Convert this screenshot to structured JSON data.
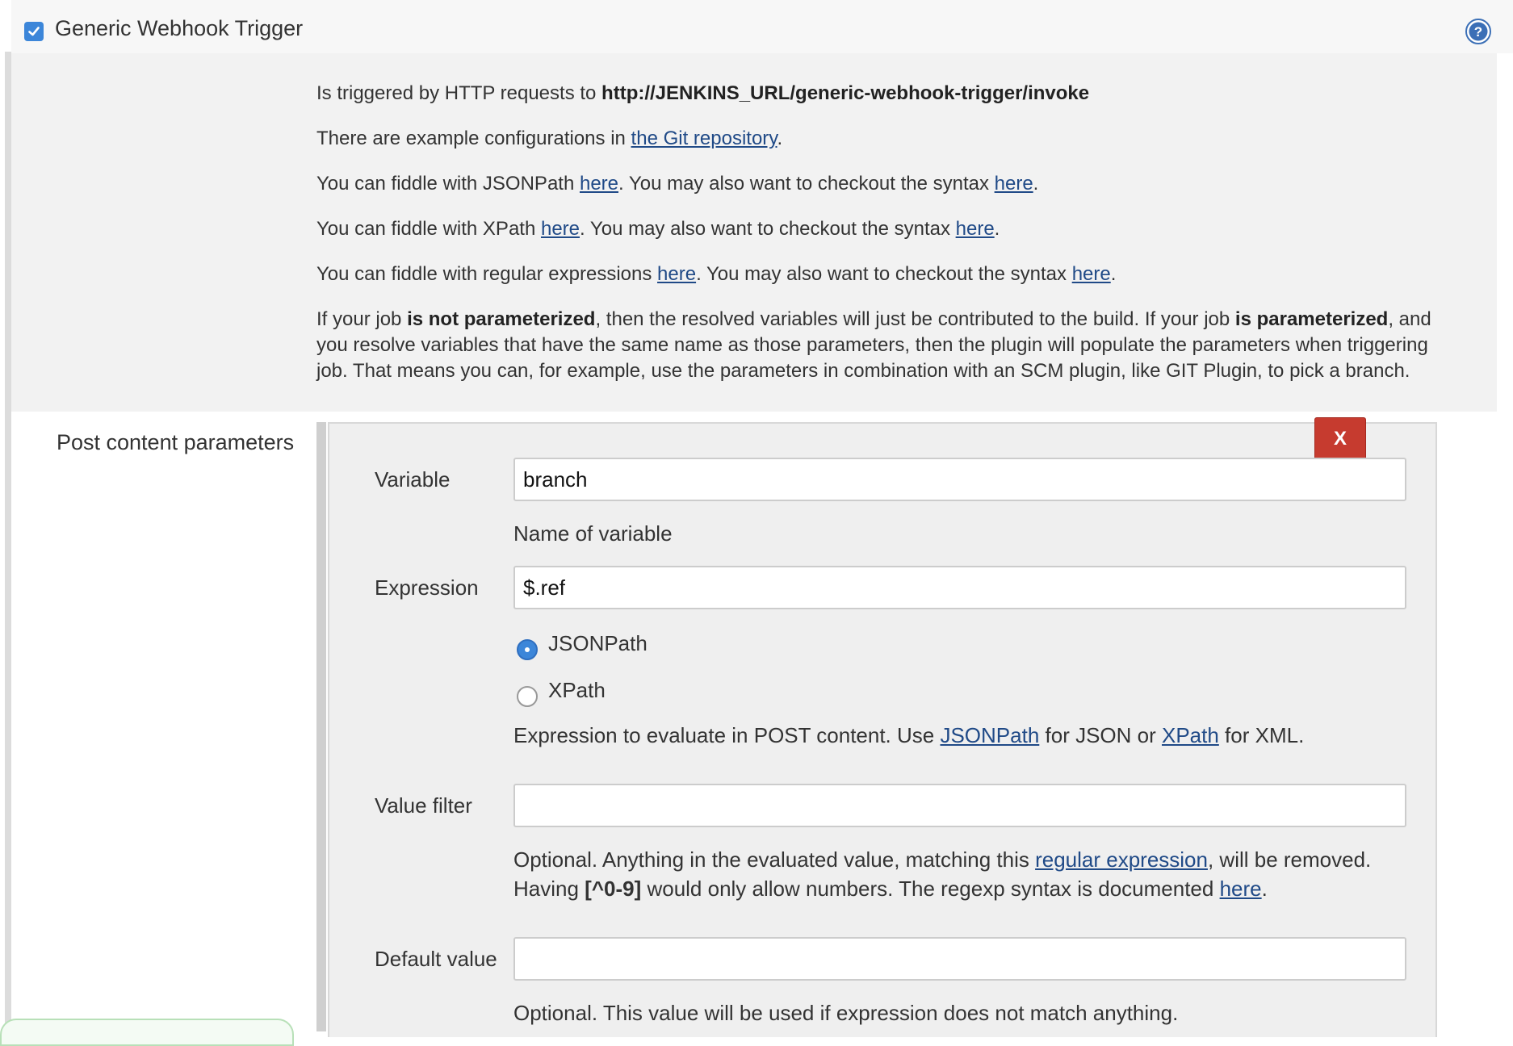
{
  "header": {
    "checkbox_checked": true,
    "title": "Generic Webhook Trigger",
    "help_icon": "question-circle-icon"
  },
  "description": {
    "line1_prefix": "Is triggered by HTTP requests to ",
    "line1_url": "http://JENKINS_URL/generic-webhook-trigger/invoke",
    "line2_prefix": "There are example configurations in ",
    "line2_link": "the Git repository",
    "line2_suffix": ".",
    "jsonpath_prefix": "You can fiddle with JSONPath ",
    "xpath_prefix": "You can fiddle with XPath ",
    "regex_prefix": "You can fiddle with regular expressions ",
    "here": "here",
    "syntax_middle": ". You may also want to checkout the syntax ",
    "period": ".",
    "param_1": "If your job ",
    "param_bold_1": "is not parameterized",
    "param_2": ", then the resolved variables will just be contributed to the build. If your job ",
    "param_bold_2": "is parameterized",
    "param_3": ", and you resolve variables that have the same name as those parameters, then the plugin will populate the parameters when triggering job. That means you can, for example, use the parameters in combination with an SCM plugin, like GIT Plugin, to pick a branch."
  },
  "post_content": {
    "section_label": "Post content parameters",
    "delete_label": "X",
    "variable_label": "Variable",
    "variable_value": "branch",
    "variable_hint": "Name of variable",
    "expression_label": "Expression",
    "expression_value": "$.ref",
    "radio_jsonpath": "JSONPath",
    "radio_xpath": "XPath",
    "selected_type": "JSONPath",
    "expr_hint_1": "Expression to evaluate in POST content. Use ",
    "expr_hint_link1": "JSONPath",
    "expr_hint_2": " for JSON or ",
    "expr_hint_link2": "XPath",
    "expr_hint_3": " for XML.",
    "value_filter_label": "Value filter",
    "value_filter_value": "",
    "filter_hint_1": "Optional. Anything in the evaluated value, matching this ",
    "filter_hint_link": "regular expression",
    "filter_hint_2": ", will be removed. Having ",
    "filter_hint_bold": "[^0-9]",
    "filter_hint_3": " would only allow numbers. The regexp syntax is documented ",
    "filter_hint_here": "here",
    "filter_hint_end": ".",
    "default_value_label": "Default value",
    "default_value_value": "",
    "default_hint": "Optional. This value will be used if expression does not match anything."
  },
  "colors": {
    "accent": "#3c86d9",
    "delete": "#c63b2f",
    "link": "#204a87"
  }
}
